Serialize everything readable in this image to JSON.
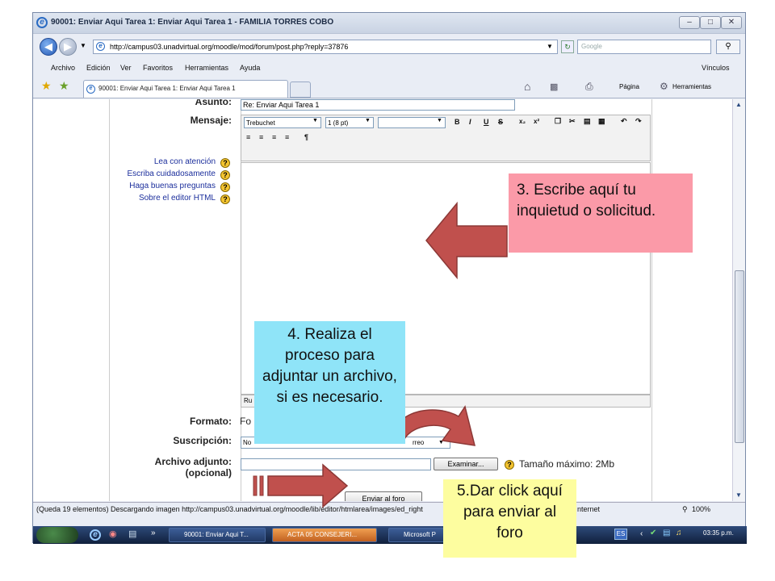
{
  "window": {
    "title": "90001: Enviar Aqui Tarea 1: Enviar Aqui Tarea 1 - FAMILIA TORRES COBO",
    "minimize": "–",
    "maximize": "□",
    "close": "✕"
  },
  "address_bar": {
    "url": "http://campus03.unadvirtual.org/moodle/mod/forum/post.php?reply=37876",
    "search_placeholder": "Google"
  },
  "menu": {
    "items": [
      "Archivo",
      "Edición",
      "Ver",
      "Favoritos",
      "Herramientas",
      "Ayuda"
    ],
    "links": "Vínculos"
  },
  "tab": {
    "title": "90001: Enviar Aqui Tarea 1: Enviar Aqui Tarea 1",
    "page_label": "Página",
    "tools_label": "Herramientas"
  },
  "form": {
    "asunto_label": "Asunto:",
    "asunto_value": "Re: Enviar Aqui Tarea 1",
    "mensaje_label": "Mensaje:",
    "font_family": "Trebuchet",
    "font_size": "1 (8 pt)",
    "help_links": [
      "Lea con atención",
      "Escriba cuidadosamente",
      "Haga buenas preguntas",
      "Sobre el editor HTML"
    ],
    "path_label": "Ru",
    "formato_label": "Formato:",
    "formato_value": "Fo",
    "suscripcion_label": "Suscripción:",
    "suscripcion_value": "No",
    "suscripcion_select": "rreo",
    "adjunto_label_1": "Archivo adjunto:",
    "adjunto_label_2": "(opcional)",
    "browse_button": "Examinar...",
    "max_size": "Tamaño máximo: 2Mb",
    "submit_button": "Enviar al foro",
    "help_symbol": "?"
  },
  "status": {
    "text": "(Queda 19 elementos) Descargando imagen http://campus03.unadvirtual.org/moodle/lib/editor/htmlarea/images/ed_right",
    "zone": "nternet",
    "zoom": "100%"
  },
  "taskbar": {
    "tasks": [
      "90001: Enviar Aqui T...",
      "ACTA 05 CONSEJERI...",
      "Microsoft P"
    ],
    "lang": "ES",
    "clock": "03:35 p.m."
  },
  "callouts": {
    "step3": "3. Escribe aquí tu inquietud o solicitud.",
    "step4": "4. Realiza el proceso para adjuntar un archivo, si es necesario.",
    "step5": "5.Dar click aquí para enviar al foro"
  },
  "colors": {
    "callout3": "#fb9aa8",
    "callout4": "#8fe4f8",
    "callout5": "#fdfd9f",
    "arrow": "#c0504d"
  }
}
